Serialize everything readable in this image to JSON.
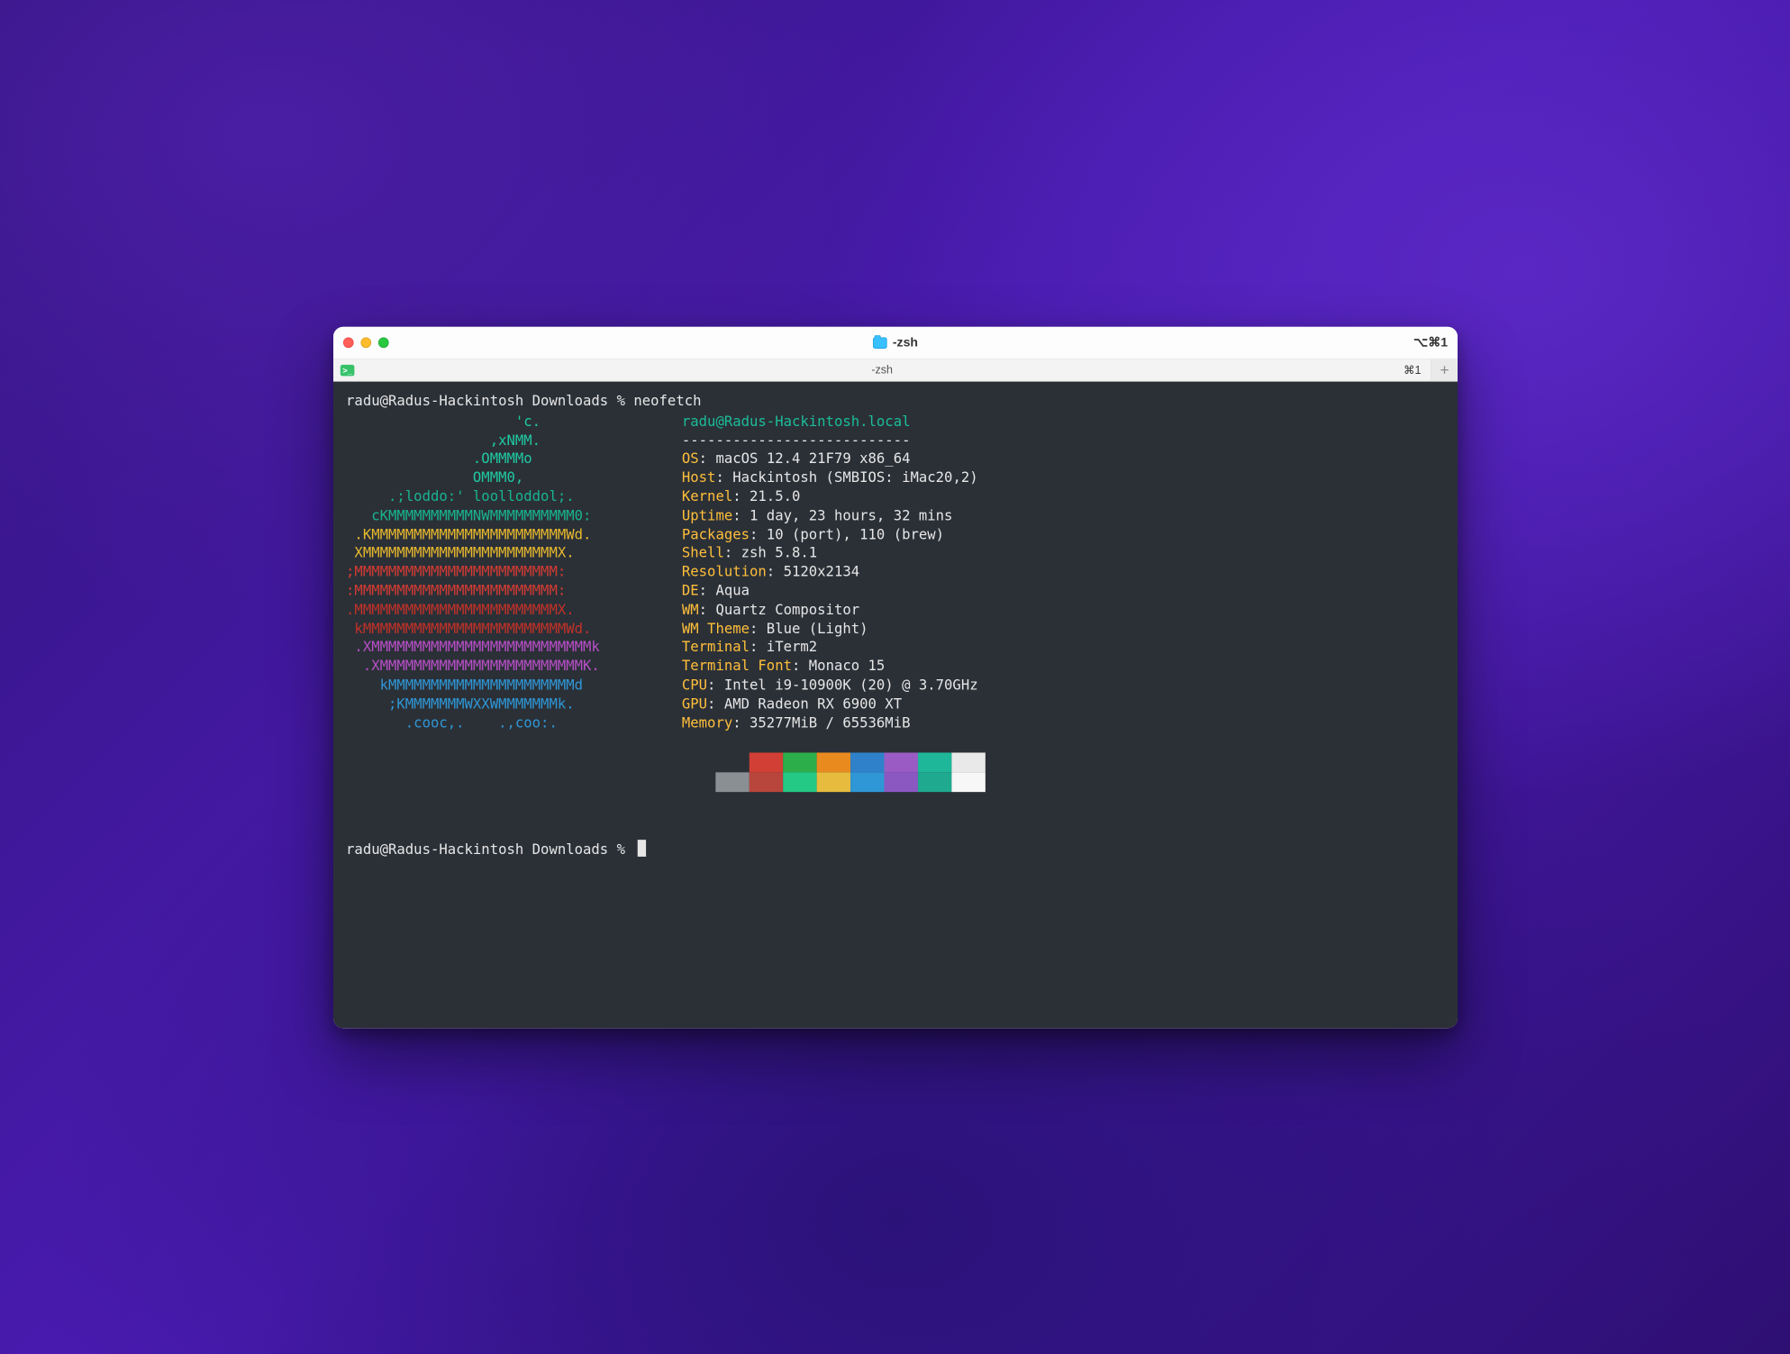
{
  "window": {
    "title_icon": "folder-icon",
    "title_text": "-zsh",
    "right_shortcut": "⌥⌘1"
  },
  "tabbar": {
    "tab_label": "-zsh",
    "tab_shortcut": "⌘1",
    "prompt_badge_glyph": ">_",
    "add_glyph": "+"
  },
  "prompt": {
    "line1": "radu@Radus-Hackintosh Downloads % neofetch",
    "line2": "radu@Radus-Hackintosh Downloads % "
  },
  "ascii": {
    "l00": "                    'c.",
    "l01": "                 ,xNMM.",
    "l02": "               .OMMMMo",
    "l03": "               OMMM0,",
    "l04": "     .;loddo:' loolloddol;.",
    "l05": "   cKMMMMMMMMMMNWMMMMMMMMMM0:",
    "l06": " .KMMMMMMMMMMMMMMMMMMMMMMMWd.",
    "l07": " XMMMMMMMMMMMMMMMMMMMMMMMX.",
    "l08": ";MMMMMMMMMMMMMMMMMMMMMMMM:",
    "l09": ":MMMMMMMMMMMMMMMMMMMMMMMM:",
    "l10": ".MMMMMMMMMMMMMMMMMMMMMMMMX.",
    "l11": " kMMMMMMMMMMMMMMMMMMMMMMMMWd.",
    "l12": " .XMMMMMMMMMMMMMMMMMMMMMMMMMMk",
    "l13": "  .XMMMMMMMMMMMMMMMMMMMMMMMMK.",
    "l14": "    kMMMMMMMMMMMMMMMMMMMMMMd",
    "l15": "     ;KMMMMMMMWXXWMMMMMMMk.",
    "l16": "       .cooc,.    .,coo:."
  },
  "info": {
    "userhost_user": "radu",
    "userhost_at": "@",
    "userhost_host": "Radus-Hackintosh.local",
    "dashes": "---------------------------",
    "rows": [
      {
        "label": "OS",
        "value": "macOS 12.4 21F79 x86_64"
      },
      {
        "label": "Host",
        "value": "Hackintosh (SMBIOS: iMac20,2)"
      },
      {
        "label": "Kernel",
        "value": "21.5.0"
      },
      {
        "label": "Uptime",
        "value": "1 day, 23 hours, 32 mins"
      },
      {
        "label": "Packages",
        "value": "10 (port), 110 (brew)"
      },
      {
        "label": "Shell",
        "value": "zsh 5.8.1"
      },
      {
        "label": "Resolution",
        "value": "5120x2134"
      },
      {
        "label": "DE",
        "value": "Aqua"
      },
      {
        "label": "WM",
        "value": "Quartz Compositor"
      },
      {
        "label": "WM Theme",
        "value": "Blue (Light)"
      },
      {
        "label": "Terminal",
        "value": "iTerm2"
      },
      {
        "label": "Terminal Font",
        "value": "Monaco 15"
      },
      {
        "label": "CPU",
        "value": "Intel i9-10900K (20) @ 3.70GHz"
      },
      {
        "label": "GPU",
        "value": "AMD Radeon RX 6900 XT"
      },
      {
        "label": "Memory",
        "value": "35277MiB / 65536MiB"
      }
    ]
  },
  "palette": {
    "row1": [
      "#2b3037",
      "#d23f34",
      "#2cae4a",
      "#e98a1f",
      "#2f82c9",
      "#9a5cc4",
      "#1fb79a",
      "#e9e9e9"
    ],
    "row2": [
      "#8a8f94",
      "#b8463c",
      "#24c986",
      "#e7bb3e",
      "#2f97d6",
      "#8b58c2",
      "#1fa98f",
      "#f7f7f7"
    ]
  }
}
